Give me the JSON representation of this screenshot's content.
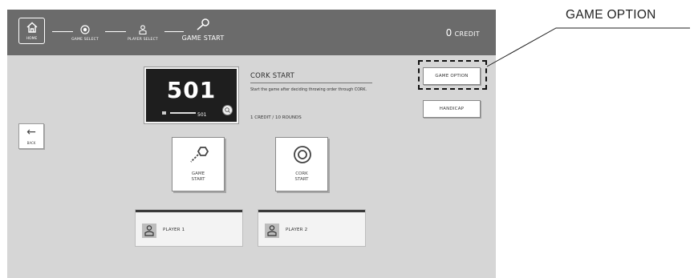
{
  "topbar": {
    "home_label": "HOME",
    "steps": [
      {
        "label": "GAME SELECT",
        "icon": "target-icon"
      },
      {
        "label": "PLAYER SELECT",
        "icon": "person-icon"
      },
      {
        "label": "GAME START",
        "icon": "dart-icon"
      }
    ],
    "credit_value": "0",
    "credit_label": "CREDIT"
  },
  "back_label": "BACK",
  "preview": {
    "score": "501",
    "sub_value": "501",
    "zoom_icon": "magnifier-icon"
  },
  "info": {
    "title": "CORK START",
    "description": "Start the game after deciding throwing order through CORK.",
    "meta": "1 CREDIT / 10 ROUNDS"
  },
  "side_buttons": {
    "game_option": "GAME OPTION",
    "handicap": "HANDICAP"
  },
  "tiles": {
    "game_start": [
      "GAME",
      "START"
    ],
    "cork_start": [
      "CORK",
      "START"
    ]
  },
  "players": [
    {
      "name": "PLAYER 1"
    },
    {
      "name": "PLAYER 2"
    }
  ],
  "callout": {
    "label": "GAME OPTION"
  },
  "colors": {
    "topbar": "#6b6b6b",
    "screen": "#d6d6d6",
    "panel": "#ffffff"
  }
}
